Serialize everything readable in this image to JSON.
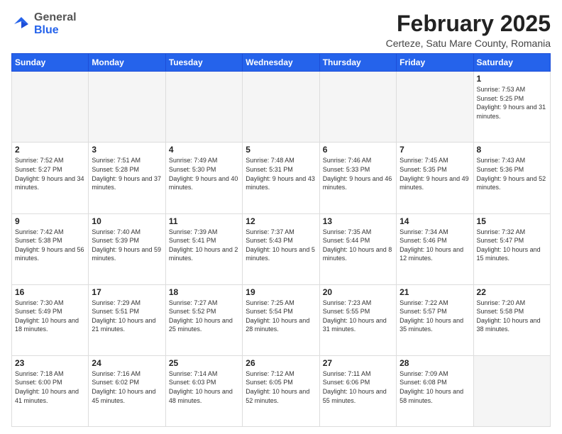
{
  "app": {
    "logo_general": "General",
    "logo_blue": "Blue"
  },
  "header": {
    "month_title": "February 2025",
    "subtitle": "Certeze, Satu Mare County, Romania"
  },
  "days_of_week": [
    "Sunday",
    "Monday",
    "Tuesday",
    "Wednesday",
    "Thursday",
    "Friday",
    "Saturday"
  ],
  "weeks": [
    [
      {
        "day": "",
        "info": ""
      },
      {
        "day": "",
        "info": ""
      },
      {
        "day": "",
        "info": ""
      },
      {
        "day": "",
        "info": ""
      },
      {
        "day": "",
        "info": ""
      },
      {
        "day": "",
        "info": ""
      },
      {
        "day": "1",
        "info": "Sunrise: 7:53 AM\nSunset: 5:25 PM\nDaylight: 9 hours and 31 minutes."
      }
    ],
    [
      {
        "day": "2",
        "info": "Sunrise: 7:52 AM\nSunset: 5:27 PM\nDaylight: 9 hours and 34 minutes."
      },
      {
        "day": "3",
        "info": "Sunrise: 7:51 AM\nSunset: 5:28 PM\nDaylight: 9 hours and 37 minutes."
      },
      {
        "day": "4",
        "info": "Sunrise: 7:49 AM\nSunset: 5:30 PM\nDaylight: 9 hours and 40 minutes."
      },
      {
        "day": "5",
        "info": "Sunrise: 7:48 AM\nSunset: 5:31 PM\nDaylight: 9 hours and 43 minutes."
      },
      {
        "day": "6",
        "info": "Sunrise: 7:46 AM\nSunset: 5:33 PM\nDaylight: 9 hours and 46 minutes."
      },
      {
        "day": "7",
        "info": "Sunrise: 7:45 AM\nSunset: 5:35 PM\nDaylight: 9 hours and 49 minutes."
      },
      {
        "day": "8",
        "info": "Sunrise: 7:43 AM\nSunset: 5:36 PM\nDaylight: 9 hours and 52 minutes."
      }
    ],
    [
      {
        "day": "9",
        "info": "Sunrise: 7:42 AM\nSunset: 5:38 PM\nDaylight: 9 hours and 56 minutes."
      },
      {
        "day": "10",
        "info": "Sunrise: 7:40 AM\nSunset: 5:39 PM\nDaylight: 9 hours and 59 minutes."
      },
      {
        "day": "11",
        "info": "Sunrise: 7:39 AM\nSunset: 5:41 PM\nDaylight: 10 hours and 2 minutes."
      },
      {
        "day": "12",
        "info": "Sunrise: 7:37 AM\nSunset: 5:43 PM\nDaylight: 10 hours and 5 minutes."
      },
      {
        "day": "13",
        "info": "Sunrise: 7:35 AM\nSunset: 5:44 PM\nDaylight: 10 hours and 8 minutes."
      },
      {
        "day": "14",
        "info": "Sunrise: 7:34 AM\nSunset: 5:46 PM\nDaylight: 10 hours and 12 minutes."
      },
      {
        "day": "15",
        "info": "Sunrise: 7:32 AM\nSunset: 5:47 PM\nDaylight: 10 hours and 15 minutes."
      }
    ],
    [
      {
        "day": "16",
        "info": "Sunrise: 7:30 AM\nSunset: 5:49 PM\nDaylight: 10 hours and 18 minutes."
      },
      {
        "day": "17",
        "info": "Sunrise: 7:29 AM\nSunset: 5:51 PM\nDaylight: 10 hours and 21 minutes."
      },
      {
        "day": "18",
        "info": "Sunrise: 7:27 AM\nSunset: 5:52 PM\nDaylight: 10 hours and 25 minutes."
      },
      {
        "day": "19",
        "info": "Sunrise: 7:25 AM\nSunset: 5:54 PM\nDaylight: 10 hours and 28 minutes."
      },
      {
        "day": "20",
        "info": "Sunrise: 7:23 AM\nSunset: 5:55 PM\nDaylight: 10 hours and 31 minutes."
      },
      {
        "day": "21",
        "info": "Sunrise: 7:22 AM\nSunset: 5:57 PM\nDaylight: 10 hours and 35 minutes."
      },
      {
        "day": "22",
        "info": "Sunrise: 7:20 AM\nSunset: 5:58 PM\nDaylight: 10 hours and 38 minutes."
      }
    ],
    [
      {
        "day": "23",
        "info": "Sunrise: 7:18 AM\nSunset: 6:00 PM\nDaylight: 10 hours and 41 minutes."
      },
      {
        "day": "24",
        "info": "Sunrise: 7:16 AM\nSunset: 6:02 PM\nDaylight: 10 hours and 45 minutes."
      },
      {
        "day": "25",
        "info": "Sunrise: 7:14 AM\nSunset: 6:03 PM\nDaylight: 10 hours and 48 minutes."
      },
      {
        "day": "26",
        "info": "Sunrise: 7:12 AM\nSunset: 6:05 PM\nDaylight: 10 hours and 52 minutes."
      },
      {
        "day": "27",
        "info": "Sunrise: 7:11 AM\nSunset: 6:06 PM\nDaylight: 10 hours and 55 minutes."
      },
      {
        "day": "28",
        "info": "Sunrise: 7:09 AM\nSunset: 6:08 PM\nDaylight: 10 hours and 58 minutes."
      },
      {
        "day": "",
        "info": ""
      }
    ]
  ]
}
